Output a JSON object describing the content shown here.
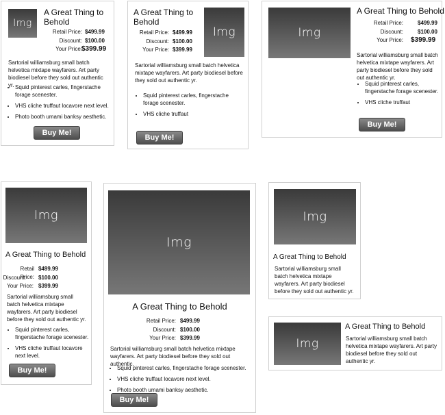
{
  "product": {
    "img_label": "Img",
    "title": "A Great Thing to Behold",
    "retail_label": "Retail Price:",
    "retail_value": "$499.99",
    "discount_label": "Discount:",
    "discount_value": "$100.00",
    "your_label": "Your Price:",
    "your_value": "$399.99",
    "desc": "Sartorial williamsburg small batch helvetica mixtape wayfarers. Art party biodiesel before they sold out authentic yr.",
    "desc_short": "Sartorial williamsburg small batch helvetica mixtape wayfarers. Art party biodiesel before they sold out authentic.",
    "bullet1": "Squid pinterest carles, fingerstache forage scenester.",
    "bullet2": "VHS cliche truffaut locavore next level.",
    "bullet2_short": "VHS cliche truffaut",
    "bullet3": "Photo booth umami banksy aesthetic.",
    "buy": "Buy Me!"
  }
}
